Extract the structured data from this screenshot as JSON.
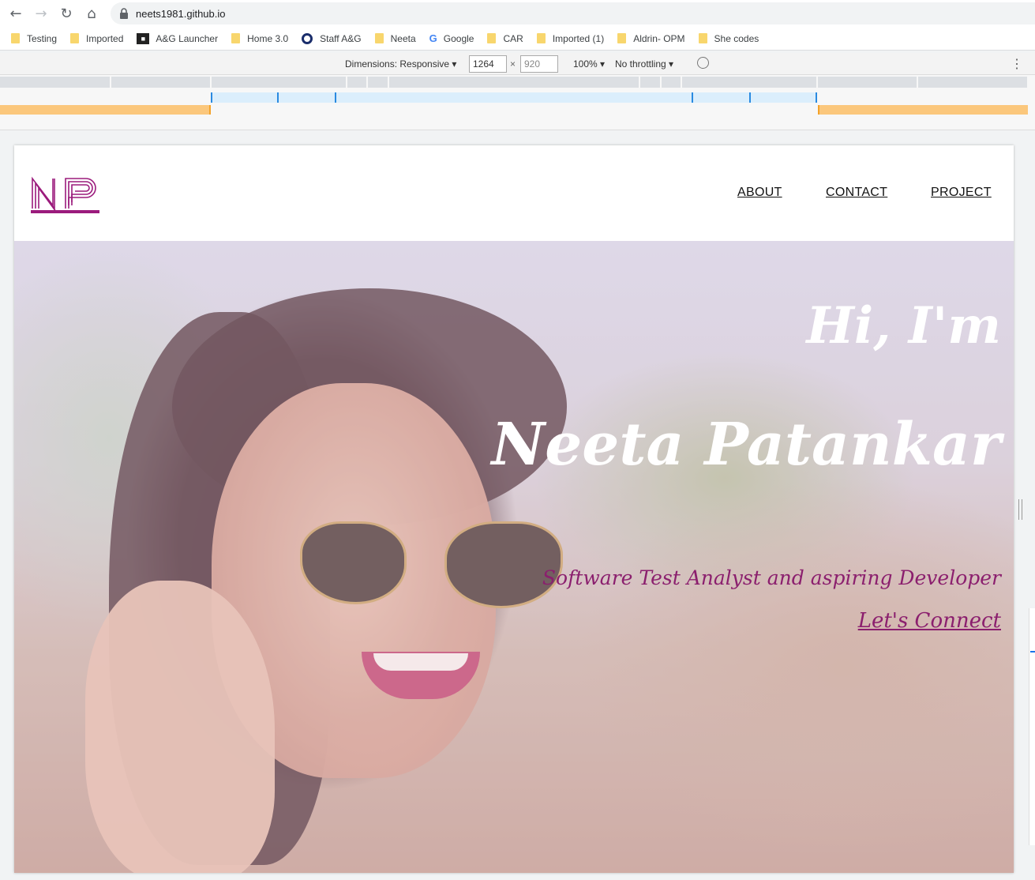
{
  "browser": {
    "url": "neets1981.github.io"
  },
  "bookmarks": [
    {
      "label": "Testing",
      "icon": "folder-icon"
    },
    {
      "label": "Imported",
      "icon": "folder-icon"
    },
    {
      "label": "A&G Launcher",
      "icon": "space-invader-icon"
    },
    {
      "label": "Home 3.0",
      "icon": "folder-icon"
    },
    {
      "label": "Staff A&G",
      "icon": "ring-icon"
    },
    {
      "label": "Neeta",
      "icon": "folder-icon"
    },
    {
      "label": "Google",
      "icon": "google-icon"
    },
    {
      "label": "CAR",
      "icon": "folder-icon"
    },
    {
      "label": "Imported (1)",
      "icon": "folder-icon"
    },
    {
      "label": "Aldrin- OPM",
      "icon": "folder-icon"
    },
    {
      "label": "She codes",
      "icon": "folder-icon"
    }
  ],
  "devtools": {
    "dimensions_label": "Dimensions: Responsive",
    "width": "1264",
    "height": "920",
    "times": "×",
    "zoom": "100%",
    "throttling": "No throttling"
  },
  "site": {
    "logo_text": "NP",
    "nav": {
      "about": "ABOUT",
      "contact": "CONTACT",
      "project": "PROJECT"
    },
    "hero": {
      "greeting": "Hi, I'm",
      "name": "Neeta Patankar",
      "tagline": "Software Test Analyst and aspiring Developer",
      "cta": "Let's Connect"
    }
  },
  "colors": {
    "brand": "#9b1b7c",
    "tagline": "#8b1f6e"
  }
}
